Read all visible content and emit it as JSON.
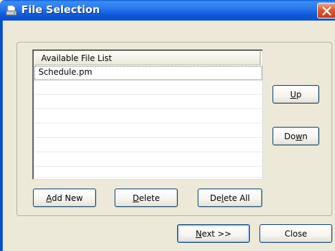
{
  "window": {
    "title": "File Selection",
    "icon": "document-drive-icon",
    "close_icon": "close-x-icon"
  },
  "file_list": {
    "column_header": "Available File List",
    "items": [
      "Schedule.pm"
    ],
    "empty_rows": 7
  },
  "buttons": {
    "up": {
      "accel": "U",
      "rest": "p"
    },
    "down": {
      "pre": "Do",
      "accel": "w",
      "rest": "n"
    },
    "add_new": {
      "accel": "A",
      "rest": "dd New"
    },
    "delete": {
      "accel": "D",
      "rest": "elete"
    },
    "delete_all": {
      "pre": "De",
      "accel": "l",
      "rest": "ete All"
    },
    "next": {
      "accel": "N",
      "rest": "ext >>"
    },
    "close": "Close"
  },
  "colors": {
    "titlebar": "#0a4fc9",
    "close_button": "#e2572e",
    "dialog_face": "#ece9d8",
    "button_border": "#003c74"
  }
}
